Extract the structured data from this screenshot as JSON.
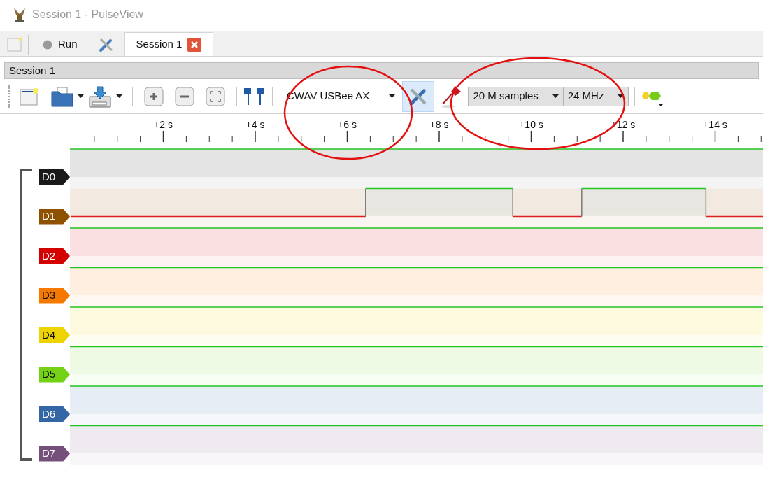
{
  "window": {
    "title": "Session 1 - PulseView"
  },
  "main_toolbar": {
    "run_label": "Run"
  },
  "tabs": [
    {
      "label": "Session 1",
      "selected": true
    }
  ],
  "session_header": "Session 1",
  "session_toolbar": {
    "device": "CWAV USBee AX",
    "config_highlighted": true,
    "sample_count": "20 M samples",
    "sample_rate": "24 MHz"
  },
  "ruler": {
    "labels": [
      "+2 s",
      "+4 s",
      "+6 s",
      "+8 s",
      "+10 s",
      "+12 s",
      "+14 s"
    ]
  },
  "channels": [
    {
      "name": "D0",
      "color": "#1a1a1a",
      "kind": "high"
    },
    {
      "name": "D1",
      "color": "#8f5000",
      "kind": "pulses"
    },
    {
      "name": "D2",
      "color": "#d40000",
      "kind": "high"
    },
    {
      "name": "D3",
      "color": "#f57900",
      "kind": "high"
    },
    {
      "name": "D4",
      "color": "#edd400",
      "kind": "high"
    },
    {
      "name": "D5",
      "color": "#73d216",
      "kind": "high"
    },
    {
      "name": "D6",
      "color": "#3465a4",
      "kind": "high"
    },
    {
      "name": "D7",
      "color": "#75507b",
      "kind": "high"
    }
  ],
  "annotations": [
    {
      "kind": "ellipse"
    },
    {
      "kind": "ellipse"
    }
  ]
}
